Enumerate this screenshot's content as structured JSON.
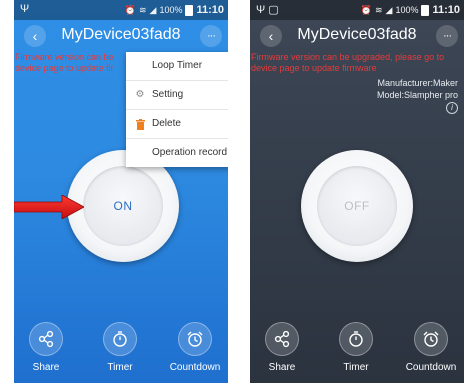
{
  "status_bar": {
    "battery": "100%",
    "time": "11:10"
  },
  "left_screen": {
    "title": "MyDevice03fad8",
    "warning_line1": "Firmware version can be",
    "warning_line2": "device page to update fir",
    "menu": [
      {
        "label": "Loop Timer",
        "icon": ""
      },
      {
        "label": "Setting",
        "icon": "gear-icon"
      },
      {
        "label": "Delete",
        "icon": "trash-icon"
      },
      {
        "label": "Operation record",
        "icon": ""
      }
    ],
    "power_state": "ON",
    "actions": [
      {
        "label": "Share",
        "icon": "share-icon"
      },
      {
        "label": "Timer",
        "icon": "timer-icon"
      },
      {
        "label": "Countdown",
        "icon": "alarm-clock-icon"
      }
    ],
    "accent_color": "#2d8ae0",
    "arrow_color": "#e0161b"
  },
  "right_screen": {
    "title": "MyDevice03fad8",
    "warning_line1": "Firmware version can be upgraded, please go to",
    "warning_line2": "device page to update firmware",
    "manufacturer": "Manufacturer:Maker",
    "model": "Model:Slampher pro",
    "power_state": "OFF",
    "actions": [
      {
        "label": "Share",
        "icon": "share-icon"
      },
      {
        "label": "Timer",
        "icon": "timer-icon"
      },
      {
        "label": "Countdown",
        "icon": "alarm-clock-icon"
      }
    ],
    "background_color": "#343d4a",
    "warning_color": "#e53b3b"
  }
}
